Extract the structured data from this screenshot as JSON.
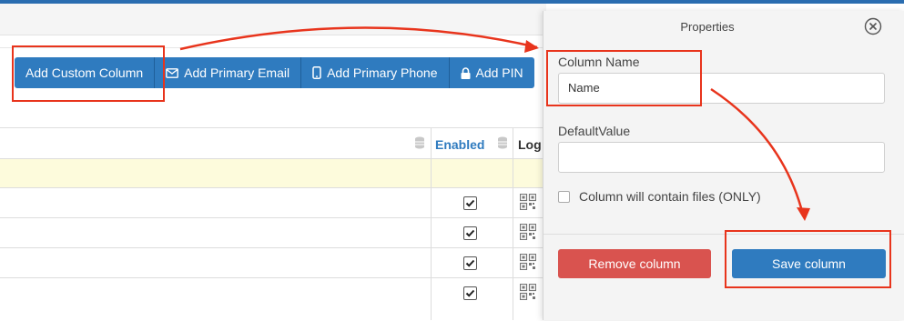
{
  "toolbar": {
    "buttons": [
      {
        "label": "Add Custom Column",
        "icon": ""
      },
      {
        "label": "Add Primary Email",
        "icon": "envelope-icon"
      },
      {
        "label": "Add Primary Phone",
        "icon": "mobile-phone-icon"
      },
      {
        "label": "Add PIN",
        "icon": "lock-icon"
      }
    ]
  },
  "grid": {
    "columns": [
      {
        "label": "Enabled",
        "color": "#2f7bbf"
      },
      {
        "label": "Log"
      }
    ],
    "rows": [
      {
        "enabled": true,
        "log_icon": "qr-code-icon"
      },
      {
        "enabled": true,
        "log_icon": "qr-code-icon"
      },
      {
        "enabled": true,
        "log_icon": "qr-code-icon"
      },
      {
        "enabled": true,
        "log_icon": "qr-code-icon"
      }
    ]
  },
  "properties_panel": {
    "title": "Properties",
    "column_name_label": "Column Name",
    "column_name_value": "Name",
    "default_value_label": "DefaultValue",
    "default_value_value": "",
    "files_only_label": "Column will contain files (ONLY)",
    "files_only_checked": false,
    "remove_button": "Remove column",
    "save_button": "Save column"
  },
  "colors": {
    "primary": "#2f7bbf",
    "danger": "#d9534f",
    "annotation": "#e8341c",
    "filter_row": "#fdfbdc"
  }
}
